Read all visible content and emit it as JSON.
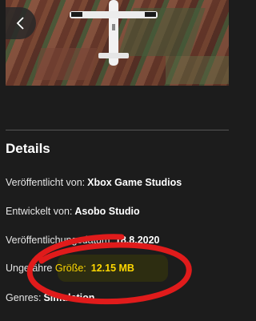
{
  "nav": {
    "back_label": "Zurück"
  },
  "details": {
    "title": "Details",
    "rows": [
      {
        "label": "Veröffentlicht von:",
        "value": "Xbox Game Studios"
      },
      {
        "label": "Entwickelt von:",
        "value": "Asobo Studio"
      },
      {
        "label": "Veröffentlichungsdatum:",
        "value": "18.8.2020"
      },
      {
        "label_prefix": "Ungefähre",
        "label_highlight": "Größe:",
        "value": "12.15 MB"
      },
      {
        "label": "Genres:",
        "value": "Simulation"
      }
    ]
  },
  "colors": {
    "background": "#1c1c1c",
    "highlight_text": "#ffd800",
    "annotation_stroke": "#e01b1b"
  },
  "icons": {
    "back": "chevron-left-icon"
  }
}
